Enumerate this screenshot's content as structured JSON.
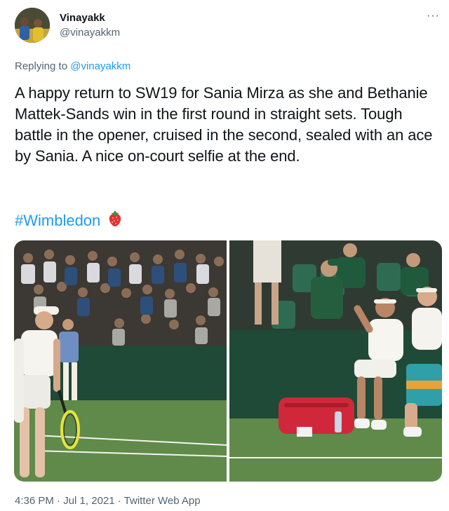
{
  "user": {
    "display_name": "Vinayakk",
    "handle": "@vinayakkm",
    "avatar_icon": "user-avatar"
  },
  "more_menu": {
    "glyph": "···",
    "icon": "more-horizontal-icon"
  },
  "reply_context": {
    "prefix": "Replying to",
    "target": "@vinayakkm"
  },
  "tweet": {
    "text": "A happy return to SW19 for Sania Mirza as she and Bethanie Mattek-Sands win in the first round in straight sets. Tough battle in the opener, cruised in the second, sealed with an ace by Sania. A nice on-court selfie at the end.",
    "hashtag": "#Wimbledon",
    "emoji_icon": "strawberry-icon"
  },
  "media": {
    "count": 2,
    "photos": [
      {
        "subject": "tennis-player-smiling-with-racket"
      },
      {
        "subject": "players-seated-courtside-selfie"
      }
    ]
  },
  "footer": {
    "time": "4:36 PM",
    "separator": " · ",
    "date": "Jul 1, 2021",
    "source": "Twitter Web App"
  },
  "colors": {
    "link": "#1d9bf0",
    "secondary_text": "#536471",
    "primary_text": "#0f1419",
    "court_grass": "#5f8a4a",
    "wall_green": "#1f4a37"
  }
}
